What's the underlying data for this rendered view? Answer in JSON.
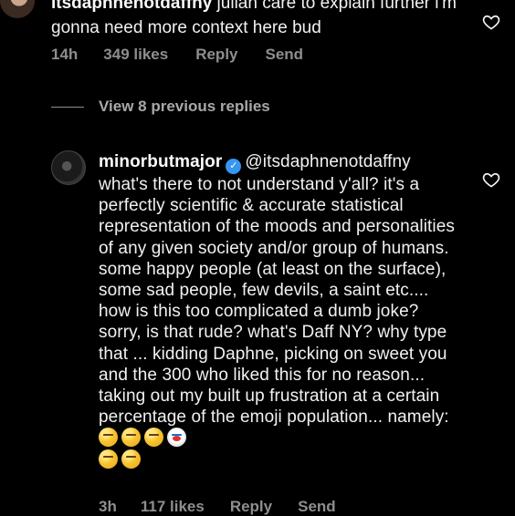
{
  "top_comment": {
    "username": "itsdaphnenotdaffny",
    "text": " julian care to explain further i'm gonna need more context here bud",
    "time": "14h",
    "likes": "349 likes",
    "reply_label": "Reply",
    "send_label": "Send"
  },
  "view_replies": {
    "label": "View 8 previous replies"
  },
  "reply": {
    "username": "minorbutmajor",
    "mention": "@itsdaphnenotdaffny",
    "text": " what's there to not understand y'all?  it's a perfectly scientific & accurate statistical representation of the moods and personalities of any given society and/or group of humans. some happy people (at least on the surface), some sad people, few devils, a saint etc.... how is this too complicated a dumb joke? sorry, is that rude?  what's Daff NY? why type that ... kidding Daphne, picking on sweet you and the 300 who liked this for no reason... taking out my built up frustration at a certain percentage of the emoji population... namely: ",
    "emojis": [
      "unamused-emoji",
      "dizzy-face-emoji",
      "zipper-mouth-emoji",
      "clown-emoji",
      "weary-emoji",
      "smirk-emoji"
    ],
    "time": "3h",
    "likes": "117 likes",
    "reply_label": "Reply",
    "send_label": "Send"
  },
  "colors": {
    "background": "#000000",
    "text": "#f1f1f1",
    "meta": "#8e8e8e",
    "verified": "#3797f0"
  }
}
